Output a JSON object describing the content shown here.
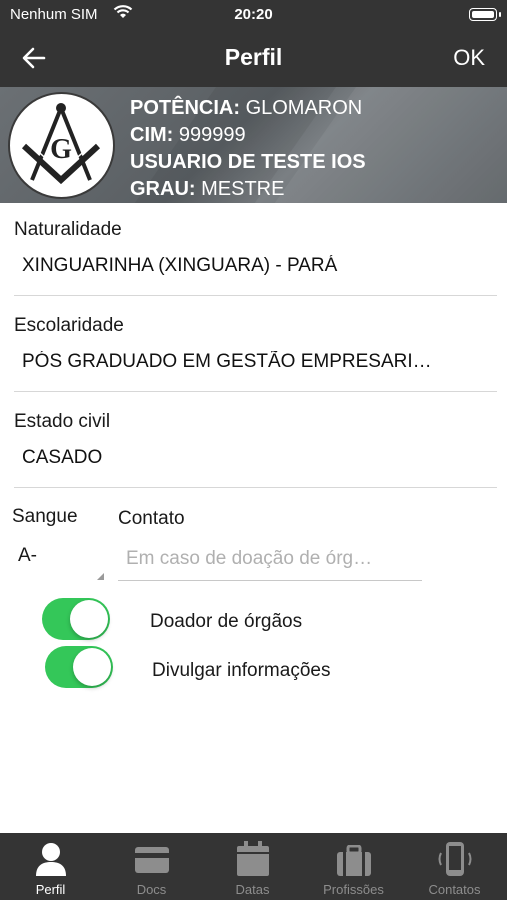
{
  "status_bar": {
    "carrier": "Nenhum SIM",
    "time": "20:20"
  },
  "nav": {
    "title": "Perfil",
    "ok_label": "OK"
  },
  "header": {
    "logo_letter": "G",
    "rows": [
      {
        "key": "POTÊNCIA:",
        "value": "GLOMARON"
      },
      {
        "key": "CIM:",
        "value": "999999"
      },
      {
        "key": "USUARIO DE TESTE IOS",
        "value": ""
      },
      {
        "key": "GRAU:",
        "value": "MESTRE"
      }
    ]
  },
  "fields": {
    "naturalidade": {
      "label": "Naturalidade",
      "value": "XINGUARINHA (XINGUARA) - PARÁ"
    },
    "escolaridade": {
      "label": "Escolaridade",
      "value": "PÓS GRADUADO EM GESTÃO EMPRESARI…"
    },
    "estado_civil": {
      "label": "Estado civil",
      "value": "CASADO"
    }
  },
  "blood": {
    "label": "Sangue",
    "value": "A-"
  },
  "contact": {
    "label": "Contato",
    "placeholder": "Em caso de doação de órg…",
    "value": ""
  },
  "toggles": [
    {
      "label": "Doador de órgãos",
      "on": true
    },
    {
      "label": "Divulgar informações",
      "on": true
    }
  ],
  "tabs": [
    {
      "label": "Perfil",
      "icon": "person-icon",
      "active": true
    },
    {
      "label": "Docs",
      "icon": "card-icon",
      "active": false
    },
    {
      "label": "Datas",
      "icon": "calendar-icon",
      "active": false
    },
    {
      "label": "Profissões",
      "icon": "briefcase-icon",
      "active": false
    },
    {
      "label": "Contatos",
      "icon": "phone-icon",
      "active": false
    }
  ],
  "colors": {
    "bar": "#343434",
    "toggle_on": "#34c759",
    "tab_active": "#ffffff",
    "tab_inactive": "#8d8d8d"
  }
}
